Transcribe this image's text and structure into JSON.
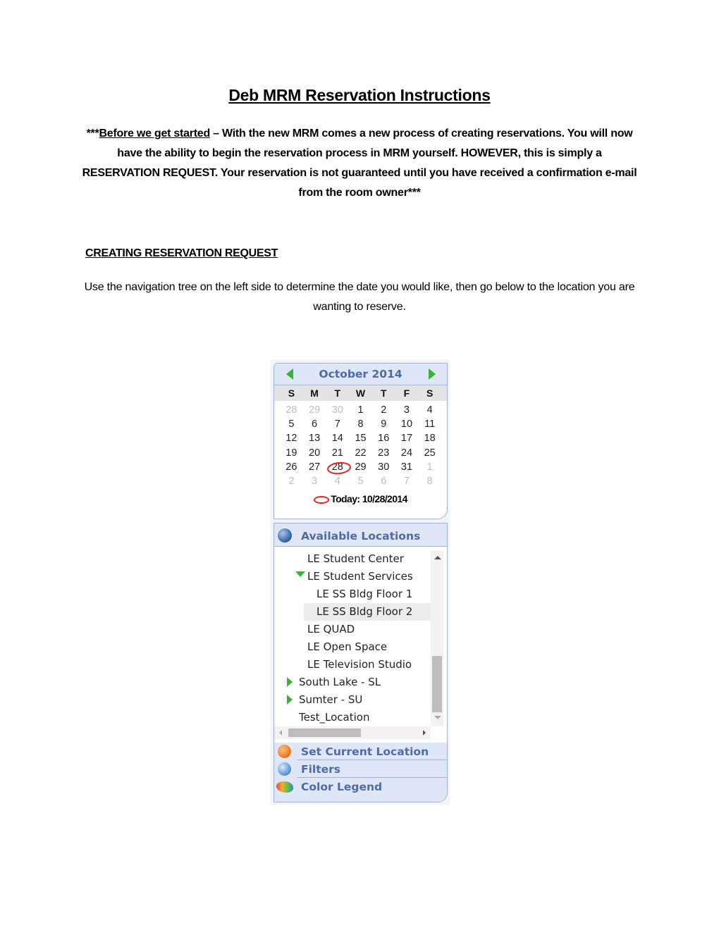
{
  "document": {
    "title": "Deb MRM Reservation Instructions",
    "intro": {
      "prefix": "***",
      "underlined": "Before we get started",
      "text": " – With the new MRM comes a new process of creating reservations. You will now have the ability to begin the reservation process in MRM yourself. HOWEVER, this is simply a RESERVATION REQUEST. Your reservation is not guaranteed until you have received a confirmation e-mail from the room owner***"
    },
    "section_heading": "CREATING RESERVATION REQUEST",
    "body_text": "Use the navigation tree on the left side to determine the date you would like, then go below to the location you are wanting to reserve."
  },
  "calendar": {
    "month_label": "October 2014",
    "prev_icon": "prev-month-arrow",
    "next_icon": "next-month-arrow",
    "weekdays": [
      "S",
      "M",
      "T",
      "W",
      "T",
      "F",
      "S"
    ],
    "weeks": [
      [
        {
          "d": "28",
          "other": true
        },
        {
          "d": "29",
          "other": true
        },
        {
          "d": "30",
          "other": true
        },
        {
          "d": "1"
        },
        {
          "d": "2"
        },
        {
          "d": "3"
        },
        {
          "d": "4"
        }
      ],
      [
        {
          "d": "5"
        },
        {
          "d": "6"
        },
        {
          "d": "7"
        },
        {
          "d": "8"
        },
        {
          "d": "9"
        },
        {
          "d": "10"
        },
        {
          "d": "11"
        }
      ],
      [
        {
          "d": "12"
        },
        {
          "d": "13"
        },
        {
          "d": "14"
        },
        {
          "d": "15"
        },
        {
          "d": "16"
        },
        {
          "d": "17"
        },
        {
          "d": "18"
        }
      ],
      [
        {
          "d": "19"
        },
        {
          "d": "20"
        },
        {
          "d": "21"
        },
        {
          "d": "22"
        },
        {
          "d": "23"
        },
        {
          "d": "24"
        },
        {
          "d": "25"
        }
      ],
      [
        {
          "d": "26"
        },
        {
          "d": "27"
        },
        {
          "d": "28",
          "today": true
        },
        {
          "d": "29"
        },
        {
          "d": "30"
        },
        {
          "d": "31"
        },
        {
          "d": "1",
          "other": true
        }
      ],
      [
        {
          "d": "2",
          "other": true
        },
        {
          "d": "3",
          "other": true
        },
        {
          "d": "4",
          "other": true
        },
        {
          "d": "5",
          "other": true
        },
        {
          "d": "6",
          "other": true
        },
        {
          "d": "7",
          "other": true
        },
        {
          "d": "8",
          "other": true
        }
      ]
    ],
    "today_label": "Today: 10/28/2014",
    "today_marker_color": "#e82020"
  },
  "locations": {
    "title": "Available Locations",
    "icon": "globe-icon",
    "nodes": [
      {
        "label": "LE Student Center",
        "indent": 2,
        "expander": "none",
        "selected": false
      },
      {
        "label": "LE Student Services",
        "indent": 2,
        "expander": "expanded",
        "selected": false
      },
      {
        "label": "LE SS Bldg Floor 1",
        "indent": 3,
        "expander": "none",
        "selected": false
      },
      {
        "label": "LE SS Bldg Floor 2",
        "indent": 3,
        "expander": "none",
        "selected": true
      },
      {
        "label": "LE QUAD",
        "indent": 2,
        "expander": "none",
        "selected": false
      },
      {
        "label": "LE Open Space",
        "indent": 2,
        "expander": "none",
        "selected": false
      },
      {
        "label": "LE Television Studio",
        "indent": 2,
        "expander": "none",
        "selected": false
      },
      {
        "label": "South Lake - SL",
        "indent": 1,
        "expander": "collapsed",
        "selected": false
      },
      {
        "label": "Sumter - SU",
        "indent": 1,
        "expander": "collapsed",
        "selected": false
      },
      {
        "label": "Test_Location",
        "indent": 1,
        "expander": "none",
        "selected": false
      }
    ]
  },
  "accordion": [
    {
      "label": "Set Current Location",
      "icon": "orange-globe-icon"
    },
    {
      "label": "Filters",
      "icon": "filter-globe-icon"
    },
    {
      "label": "Color Legend",
      "icon": "chameleon-icon"
    }
  ],
  "colors": {
    "panel_header_bg": "#dfe7f6",
    "panel_header_text": "#4f6aa6",
    "panel_border": "#9fb3dc",
    "tree_expander": "#3cb03c"
  }
}
